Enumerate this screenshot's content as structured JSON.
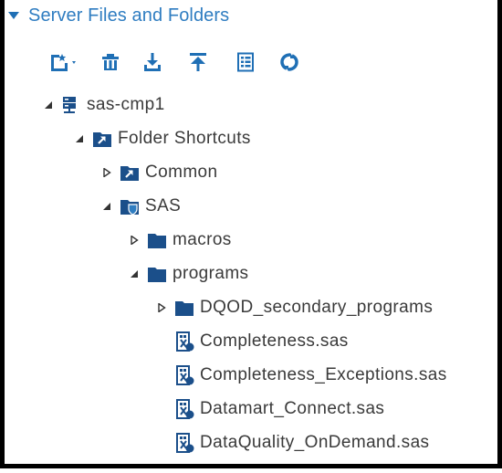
{
  "panel": {
    "title": "Server Files and Folders"
  },
  "toolbar": {
    "buttons": [
      {
        "name": "new-button",
        "icon": "new-file-icon"
      },
      {
        "name": "delete-button",
        "icon": "trash-icon"
      },
      {
        "name": "download-button",
        "icon": "download-icon"
      },
      {
        "name": "upload-button",
        "icon": "upload-icon"
      },
      {
        "name": "properties-button",
        "icon": "properties-list-icon"
      },
      {
        "name": "refresh-button",
        "icon": "refresh-icon"
      }
    ]
  },
  "tree": {
    "items": [
      {
        "label": "sas-cmp1",
        "icon": "server-icon",
        "state": "expanded",
        "depth": 0
      },
      {
        "label": "Folder Shortcuts",
        "icon": "shortcut-folder-icon",
        "state": "expanded",
        "depth": 1
      },
      {
        "label": "Common",
        "icon": "shortcut-folder-icon",
        "state": "collapsed",
        "depth": 2
      },
      {
        "label": "SAS",
        "icon": "sas-folder-icon",
        "state": "expanded",
        "depth": 2
      },
      {
        "label": "macros",
        "icon": "folder-icon",
        "state": "collapsed",
        "depth": 3
      },
      {
        "label": "programs",
        "icon": "folder-icon",
        "state": "expanded",
        "depth": 3
      },
      {
        "label": "DQOD_secondary_programs",
        "icon": "folder-icon",
        "state": "collapsed",
        "depth": 4
      },
      {
        "label": "Completeness.sas",
        "icon": "sas-program-file-icon",
        "state": "leaf",
        "depth": 4
      },
      {
        "label": "Completeness_Exceptions.sas",
        "icon": "sas-program-file-icon",
        "state": "leaf",
        "depth": 4
      },
      {
        "label": "Datamart_Connect.sas",
        "icon": "sas-program-file-icon",
        "state": "leaf",
        "depth": 4
      },
      {
        "label": "DataQuality_OnDemand.sas",
        "icon": "sas-program-file-icon",
        "state": "leaf",
        "depth": 4
      }
    ]
  },
  "colors": {
    "accent": "#2f7dc1",
    "icon_blue": "#1f6fb5",
    "folder": "#1b4f8a",
    "text": "#3a3a3a"
  }
}
